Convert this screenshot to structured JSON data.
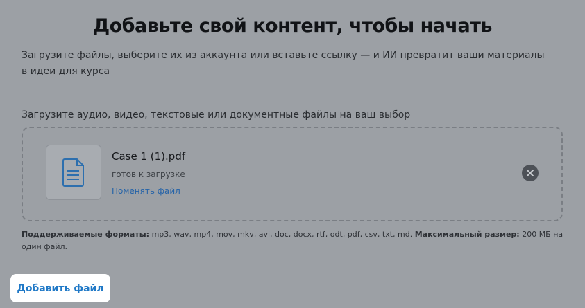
{
  "header": {
    "title": "Добавьте свой контент, чтобы начать",
    "subtitle": "Загрузите файлы, выберите их из аккаунта или вставьте ссылку — и ИИ превратит ваши материалы в идеи для курса"
  },
  "upload": {
    "label": "Загрузите аудио, видео, текстовые или документные файлы на ваш выбор",
    "file": {
      "icon": "document-icon",
      "name": "Case 1 (1).pdf",
      "status": "готов к загрузке",
      "change_label": "Поменять файл"
    },
    "remove_icon": "close-icon"
  },
  "formats": {
    "supported_label": "Поддерживаемые форматы:",
    "supported_list": " mp3, wav, mp4, mov, mkv, avi, doc, docx, rtf, odt, pdf, csv, txt, md. ",
    "max_label": "Максимальный размер:",
    "max_value": " 200 МБ на один файл."
  },
  "actions": {
    "add_file_label": "Добавить файл"
  },
  "colors": {
    "overlay_background": "#9ca0a5",
    "link": "#2563a8",
    "primary_text_button": "#2079c7"
  }
}
